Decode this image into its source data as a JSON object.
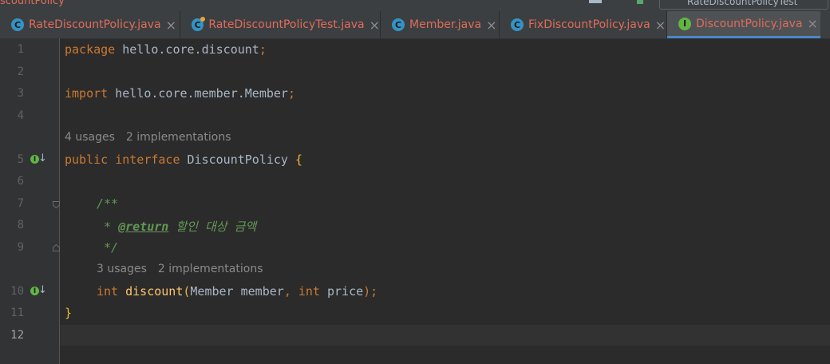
{
  "top": {
    "left_crumb": "scountPolicy",
    "run_config": "RateDiscountPolicyTest"
  },
  "tabs": [
    {
      "label": "RateDiscountPolicy.java",
      "icon": "C",
      "active": false
    },
    {
      "label": "RateDiscountPolicyTest.java",
      "icon": "C",
      "active": false
    },
    {
      "label": "Member.java",
      "icon": "C",
      "active": false
    },
    {
      "label": "FixDiscountPolicy.java",
      "icon": "C",
      "active": false
    },
    {
      "label": "DiscountPolicy.java",
      "icon": "I",
      "active": true
    }
  ],
  "close_glyph": "×",
  "line_numbers": [
    "1",
    "2",
    "3",
    "4",
    "5",
    "6",
    "7",
    "8",
    "9",
    "10",
    "11",
    "12"
  ],
  "code": {
    "l1_kw": "package",
    "l1_rest": " hello.core.discount",
    "l1_semi": ";",
    "l3_kw": "import",
    "l3_rest": " hello.core.member.Member",
    "l3_semi": ";",
    "l5_kw1": "public",
    "l5_kw2": " interface",
    "l5_name": " DiscountPolicy ",
    "l5_brace": "{",
    "l7_cm": "/**",
    "l8_star": " * ",
    "l8_tag": "@return",
    "l8_text": " 할인 대상 금액",
    "l9_cm": " */",
    "l10_kw1": "int",
    "l10_fn": " discount",
    "l10_paren": "(",
    "l10_args1": "Member member",
    "l10_comma": ",",
    "l10_kw2": " int",
    "l10_args2": " price",
    "l10_end": ");",
    "l11_brace": "}"
  },
  "hints": {
    "interface_usages": "4 usages",
    "interface_impls": "2 implementations",
    "method_usages": "3 usages",
    "method_impls": "2 implementations"
  },
  "gutter_icon_letter": "I",
  "gutter_icon_arrow": "↓",
  "colors": {
    "background": "#2b2b2b",
    "keyword": "#cc7832",
    "method": "#ffc66d",
    "comment": "#629755",
    "brace": "#e8ba36",
    "tab_text": "#e06c5a",
    "active_tab_underline": "#4a88c7"
  }
}
